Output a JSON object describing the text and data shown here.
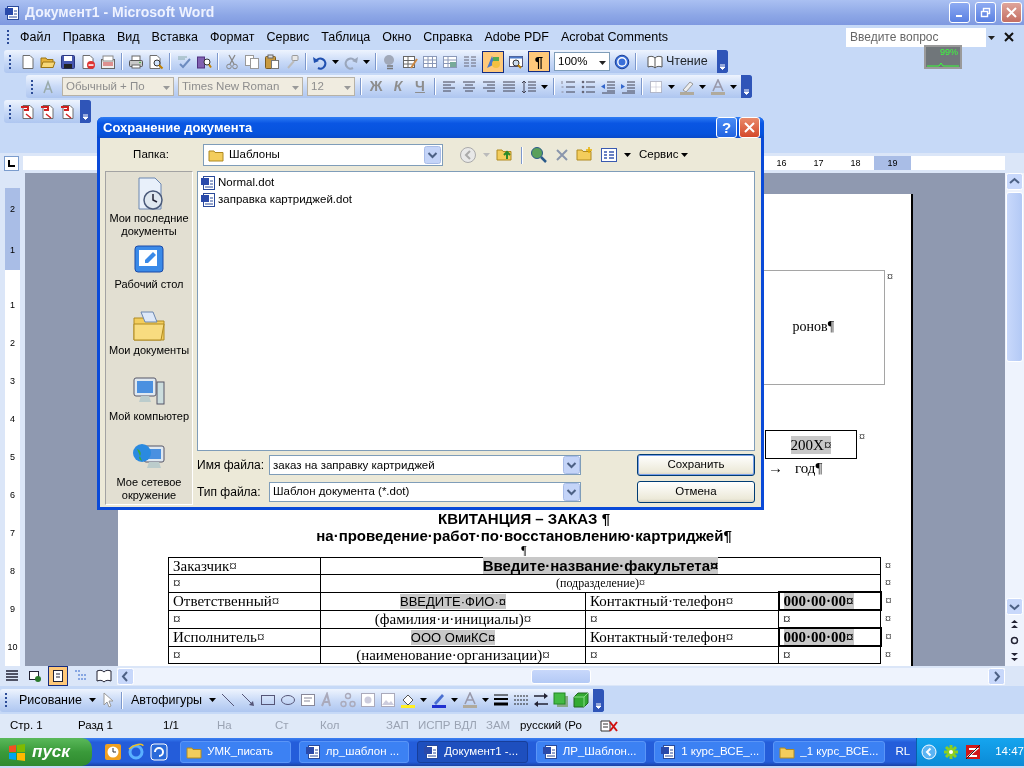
{
  "window": {
    "title": "Документ1 - Microsoft Word"
  },
  "menu": [
    "Файл",
    "Правка",
    "Вид",
    "Вставка",
    "Формат",
    "Сервис",
    "Таблица",
    "Окно",
    "Справка",
    "Adobe PDF",
    "Acrobat Comments"
  ],
  "help_box": {
    "placeholder": "Введите вопрос"
  },
  "cpu_meter": {
    "reading": "99%"
  },
  "standard_toolbar": {
    "drawing_on": true,
    "marks": {
      "text": "¶",
      "on": true
    },
    "zoom": "100%",
    "reading_button": "Чтение"
  },
  "formatting_toolbar": {
    "disabled": true,
    "style": "Обычный + По",
    "font": "Times New Roman",
    "size": "12",
    "bold": "Ж",
    "italic": "К",
    "underline": "Ч"
  },
  "ruler": {
    "h_numbers": [
      "16",
      "17",
      "18",
      "19"
    ],
    "v_numbers": [
      "2",
      "1",
      "1",
      "2",
      "3",
      "4",
      "5",
      "6",
      "7",
      "8",
      "9",
      "10"
    ]
  },
  "dialog": {
    "title": "Сохранение документа",
    "help_button": "?",
    "folder_label": "Папка:",
    "folder": "Шаблоны",
    "tools": "Сервис",
    "places": [
      "Мои последние документы",
      "Рабочий стол",
      "Мои документы",
      "Мой компьютер",
      "Мое сетевое окружение"
    ],
    "files": [
      "Normal.dot",
      "заправка картриджей.dot"
    ],
    "filename_label": "Имя файла:",
    "filename": "заказ на заправку картриджей",
    "filetype_label": "Тип файла:",
    "filetype": "Шаблон документа (*.dot)",
    "buttons": [
      {
        "label": "Сохранить",
        "default": true
      },
      {
        "label": "Отмена",
        "default": false
      }
    ]
  },
  "document": {
    "frame_text": "ронов¶",
    "frame_mark": "¤",
    "year": "200X¤",
    "year_mark": "¤",
    "tab_mark": "→",
    "year_label": "год¶",
    "heading": "КВИТАНЦИЯ – ЗАКАЗ ¶",
    "subheading": "на·проведение·работ·по·восстановлению·картриджей¶",
    "empty_para": "¶",
    "table": [
      {
        "cells": [
          {
            "text": "Заказчик¤",
            "kind": "label"
          },
          {
            "text": "Введите·название·факультета¤",
            "kind": "title_field"
          }
        ],
        "end": "¤"
      },
      {
        "cells": [
          {
            "text": "¤",
            "kind": "empty"
          },
          {
            "text": "(подразделение)¤",
            "kind": "caption"
          }
        ],
        "end": "¤"
      },
      {
        "cells": [
          {
            "text": "Ответственный¤",
            "kind": "label"
          },
          {
            "text": "ВВЕДИТЕ·ФИО·¤",
            "kind": "field"
          },
          {
            "text": "Контактный·телефон¤",
            "kind": "label"
          },
          {
            "text": "000·00·00¤",
            "kind": "phone"
          }
        ],
        "end": "¤"
      },
      {
        "cells": [
          {
            "text": "¤",
            "kind": "empty"
          },
          {
            "text": "(фамилия·и·инициалы)¤",
            "kind": "note"
          },
          {
            "text": "¤",
            "kind": "empty"
          },
          {
            "text": "¤",
            "kind": "empty"
          }
        ],
        "end": "¤"
      },
      {
        "cells": [
          {
            "text": "Исполнитель¤",
            "kind": "label"
          },
          {
            "text": "ООО ОмиКС¤",
            "kind": "field"
          },
          {
            "text": "Контактный·телефон¤",
            "kind": "label"
          },
          {
            "text": "000·00·00¤",
            "kind": "phone"
          }
        ],
        "end": "¤"
      },
      {
        "cells": [
          {
            "text": "¤",
            "kind": "empty"
          },
          {
            "text": "(наименование·организации)¤",
            "kind": "note"
          },
          {
            "text": "¤",
            "kind": "empty"
          },
          {
            "text": "¤",
            "kind": "empty"
          }
        ],
        "end": "¤"
      }
    ]
  },
  "view_modes": [
    {
      "selected": false
    },
    {
      "selected": false
    },
    {
      "selected": true
    },
    {
      "selected": false
    },
    {
      "selected": false
    }
  ],
  "drawing_toolbar": {
    "menu": "Рисование",
    "autoshapes": "Автофигуры"
  },
  "status_bar": [
    {
      "text": "Стр. 1",
      "disabled": false
    },
    {
      "text": "Разд 1",
      "disabled": false
    },
    {
      "text": "1/1",
      "disabled": false
    },
    {
      "text": "На",
      "disabled": true
    },
    {
      "text": "Ст",
      "disabled": true
    },
    {
      "text": "Кол",
      "disabled": true
    },
    {
      "text": "ЗАП",
      "disabled": true
    },
    {
      "text": "ИСПР",
      "disabled": true
    },
    {
      "text": "ВДЛ",
      "disabled": true
    },
    {
      "text": "ЗАМ",
      "disabled": true
    },
    {
      "text": "русский (Ро",
      "disabled": false
    }
  ],
  "taskbar": {
    "start": "пуск",
    "tasks": [
      {
        "label": "УМК_писать",
        "kind": "folder",
        "selected": false
      },
      {
        "label": "лр_шаблон ...",
        "kind": "word",
        "selected": false
      },
      {
        "label": "Документ1 -...",
        "kind": "word",
        "selected": true
      },
      {
        "label": "ЛР_Шаблон...",
        "kind": "word",
        "selected": false
      },
      {
        "label": "1 курс_ВСЕ_...",
        "kind": "word",
        "selected": false
      },
      {
        "label": "_1 курс_ВСЕ...",
        "kind": "folder",
        "selected": false
      }
    ],
    "lang": "RL",
    "clock": "14:47"
  }
}
